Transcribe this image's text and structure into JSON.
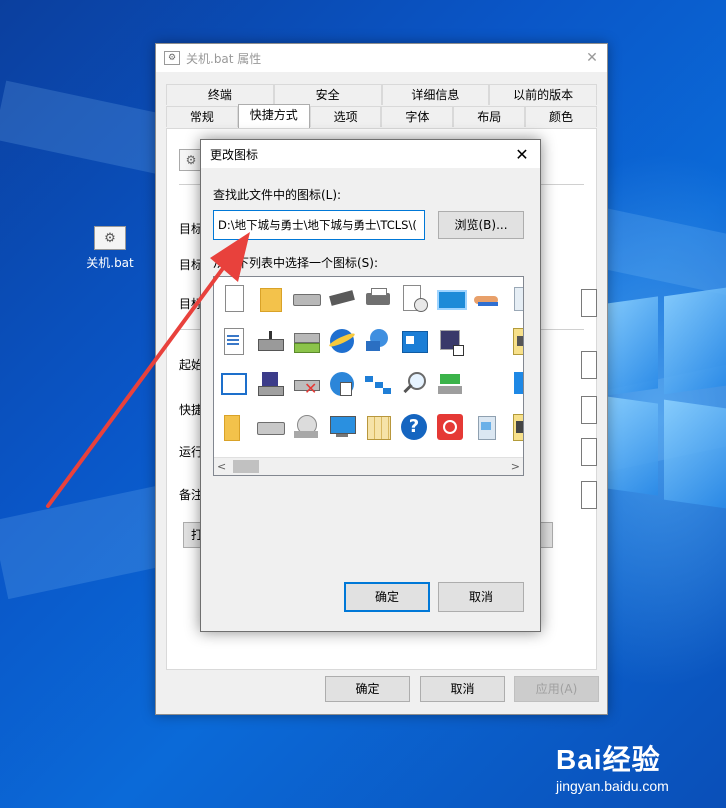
{
  "desktop": {
    "icon_label": "关机.bat",
    "icon_glyph": "gear-file-icon"
  },
  "properties_window": {
    "title": "关机.bat 属性",
    "tabs_row1": [
      "终端",
      "安全",
      "详细信息",
      "以前的版本"
    ],
    "tabs_row2": [
      "常规",
      "快捷方式",
      "选项",
      "字体",
      "布局",
      "颜色"
    ],
    "active_tab": "快捷方式",
    "field_labels": [
      "目标",
      "目标",
      "目标",
      "起始",
      "快捷",
      "运行",
      "备注"
    ],
    "partial_button_label": "打",
    "buttons": {
      "ok": "确定",
      "cancel": "取消",
      "apply": "应用(A)"
    }
  },
  "change_icon_dialog": {
    "title": "更改图标",
    "search_label": "查找此文件中的图标(L):",
    "path_value": "D:\\地下城与勇士\\地下城与勇士\\TCLS\\(",
    "browse_button": "浏览(B)...",
    "list_label": "从以下列表中选择一个图标(S):",
    "icons": [
      "blank-document-icon",
      "folder-icon",
      "drive-icon",
      "memory-chip-icon",
      "printer-icon",
      "document-clock-icon",
      "display-icon",
      "hand-share-icon",
      "recycle-bin-icon",
      "text-document-icon",
      "network-drive-icon",
      "network-server-icon",
      "internet-explorer-icon",
      "network-globe-icon",
      "control-panel-icon",
      "monitor-shortcut-icon",
      "",
      "batch-file-icon",
      "window-icon",
      "floppy-disk-icon",
      "disconnected-drive-icon",
      "globe-cursor-icon",
      "network-icon",
      "search-magnifier-icon",
      "green-arrow-icon",
      "",
      "blue-square-icon",
      "folder-partial-icon",
      "hard-drive-icon",
      "cd-drive-icon",
      "desktop-computer-icon",
      "folder-grid-icon",
      "help-question-icon",
      "power-button-icon",
      "recycle-bin-full-icon",
      "tools-icon"
    ],
    "buttons": {
      "ok": "确定",
      "cancel": "取消"
    }
  },
  "watermark": {
    "brand": "Bai经验",
    "url": "jingyan.baidu.com"
  },
  "colors": {
    "accent": "#0078d7",
    "annotation_arrow": "#e8413c"
  }
}
